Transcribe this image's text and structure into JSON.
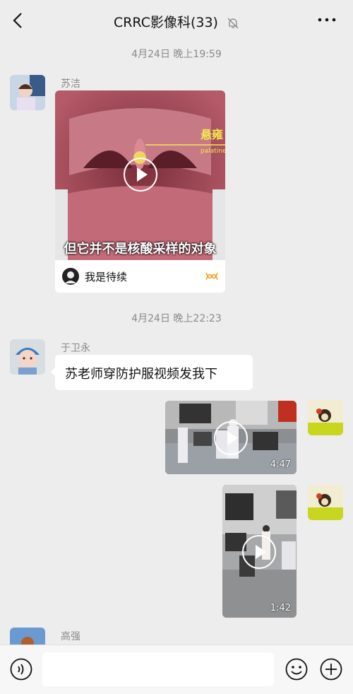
{
  "header": {
    "title": "CRRC影像科(33)",
    "back_icon": "back-arrow-icon",
    "mute_icon": "bell-muted-icon",
    "more_icon": "more-dots-icon"
  },
  "messages": {
    "time1": "4月24日 晚上19:59",
    "sender1": "苏洁",
    "card": {
      "caption": "但它并不是核酸采样的对象",
      "tag_cn": "悬雍",
      "tag_en": "palatine u",
      "author": "我是待续",
      "brand_icon": "channels-icon"
    },
    "time2": "4月24日 晚上22:23",
    "sender2": "于卫永",
    "text2": "苏老师穿防护服视频发我下",
    "video1_duration": "4:47",
    "video2_duration": "1:42",
    "sender3": "高强"
  },
  "input_bar": {
    "voice_icon": "voice-icon",
    "emoji_icon": "emoji-icon",
    "add_icon": "plus-icon",
    "placeholder": ""
  },
  "colors": {
    "background": "#ededed",
    "bubble": "#ffffff",
    "meta_text": "#8a8a8a"
  }
}
